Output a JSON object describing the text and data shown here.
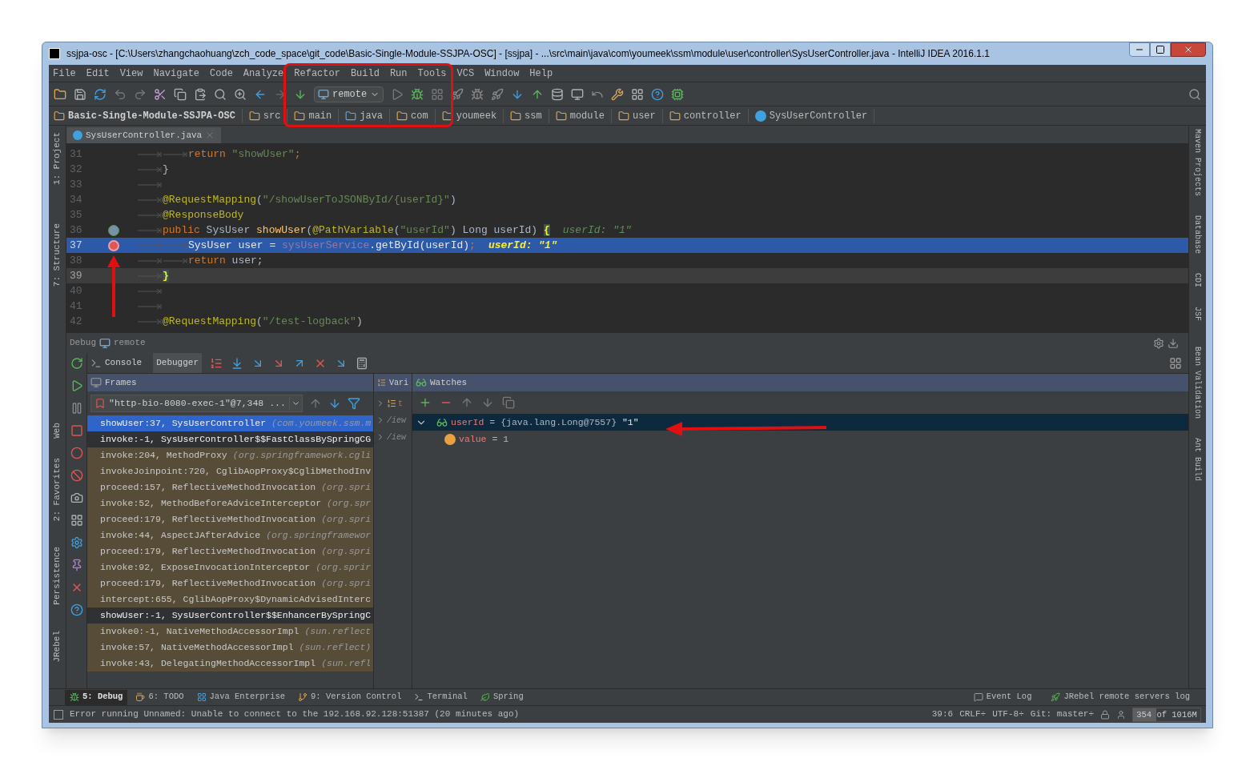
{
  "window": {
    "title": "ssjpa-osc - [C:\\Users\\zhangchaohuang\\zch_code_space\\git_code\\Basic-Single-Module-SSJPA-OSC] - [ssjpa] - ...\\src\\main\\java\\com\\youmeek\\ssm\\module\\user\\controller\\SysUserController.java - IntelliJ IDEA 2016.1.1"
  },
  "menu": [
    "File",
    "Edit",
    "View",
    "Navigate",
    "Code",
    "Analyze",
    "Refactor",
    "Build",
    "Run",
    "Tools",
    "VCS",
    "Window",
    "Help"
  ],
  "toolbar": {
    "run_config": "remote"
  },
  "breadcrumb": [
    {
      "label": "Basic-Single-Module-SSJPA-OSC",
      "kind": "project"
    },
    {
      "label": "src",
      "kind": "folder"
    },
    {
      "label": "main",
      "kind": "folder"
    },
    {
      "label": "java",
      "kind": "source"
    },
    {
      "label": "com",
      "kind": "folder"
    },
    {
      "label": "youmeek",
      "kind": "folder"
    },
    {
      "label": "ssm",
      "kind": "folder"
    },
    {
      "label": "module",
      "kind": "folder"
    },
    {
      "label": "user",
      "kind": "folder"
    },
    {
      "label": "controller",
      "kind": "folder"
    },
    {
      "label": "SysUserController",
      "kind": "class"
    }
  ],
  "left_stripe": [
    "1: Project",
    "7: Structure",
    "Web",
    "2: Favorites",
    "Persistence",
    "JRebel"
  ],
  "right_stripe": [
    "Maven Projects",
    "Database",
    "CDI",
    "JSF",
    "Bean Validation",
    "Ant Build"
  ],
  "editor": {
    "tabs": [
      {
        "label": "SysUserController.java",
        "selected": true
      }
    ],
    "lines": [
      {
        "number": "31",
        "current": false,
        "caret": false,
        "tokens": [
          {
            "tab": true
          },
          {
            "tab": true
          },
          {
            "keyword": "return"
          },
          {
            "string": " \"showUser\""
          },
          {
            "keyword": ";"
          }
        ]
      },
      {
        "number": "32",
        "current": false,
        "caret": false,
        "tokens": [
          {
            "tab": true
          },
          {
            "text": "}"
          }
        ]
      },
      {
        "number": "33",
        "current": false,
        "caret": false,
        "tokens": [
          {
            "tab": true
          }
        ]
      },
      {
        "number": "34",
        "current": false,
        "caret": false,
        "tokens": [
          {
            "tab": true
          },
          {
            "annotation": "@RequestMapping"
          },
          {
            "text": "("
          },
          {
            "string": "\"/showUserToJSONById/{userId}\""
          },
          {
            "text": ")"
          }
        ]
      },
      {
        "number": "35",
        "current": false,
        "caret": false,
        "tokens": [
          {
            "tab": true
          },
          {
            "annotation": "@ResponseBody"
          }
        ]
      },
      {
        "number": "36",
        "current": false,
        "caret": false,
        "override_marker": true,
        "breakpoint": false,
        "tokens": [
          {
            "tab": true
          },
          {
            "keyword": "public"
          },
          {
            "text": " SysUser "
          },
          {
            "method": "showUser"
          },
          {
            "text": "("
          },
          {
            "annotation": "@PathVariable"
          },
          {
            "text": "("
          },
          {
            "string": "\"userId\""
          },
          {
            "text": ") Long userId) "
          },
          {
            "brace": "{"
          },
          {
            "hint": "userId: \"1\""
          }
        ]
      },
      {
        "number": "37",
        "current": true,
        "caret": false,
        "override_marker": false,
        "breakpoint": true,
        "tokens": [
          {
            "tab": true
          },
          {
            "tab": true
          },
          {
            "text": "SysUser user = "
          },
          {
            "field": "sysUserService"
          },
          {
            "text": ".getById(userId)"
          },
          {
            "keyword": ";"
          },
          {
            "hint": "userId: \"1\""
          }
        ]
      },
      {
        "number": "38",
        "current": false,
        "caret": false,
        "tokens": [
          {
            "tab": true
          },
          {
            "tab": true
          },
          {
            "keyword": "return"
          },
          {
            "text": " user;"
          }
        ]
      },
      {
        "number": "39",
        "current": false,
        "caret": true,
        "tokens": [
          {
            "tab": true
          },
          {
            "brace": "}"
          }
        ]
      },
      {
        "number": "40",
        "current": false,
        "caret": false,
        "tokens": [
          {
            "tab": true
          }
        ]
      },
      {
        "number": "41",
        "current": false,
        "caret": false,
        "tokens": [
          {
            "tab": true
          }
        ]
      },
      {
        "number": "42",
        "current": false,
        "caret": false,
        "tokens": [
          {
            "tab": true
          },
          {
            "annotation": "@RequestMapping"
          },
          {
            "text": "("
          },
          {
            "string": "\"/test-logback\""
          },
          {
            "text": ")"
          }
        ]
      }
    ]
  },
  "debug": {
    "title": "Debug",
    "config": "remote",
    "tabs": [
      {
        "label": "Console",
        "selected": false
      },
      {
        "label": "Debugger",
        "selected": true
      }
    ],
    "frames": {
      "title": "Frames",
      "thread": "\"http-bio-8080-exec-1\"@7,348 ...",
      "rows": [
        {
          "text": "showUser:37, SysUserController",
          "package": "(com.youmeek.ssm.m",
          "selected": true,
          "kind": "project"
        },
        {
          "text": "invoke:-1, SysUserController$$FastClassBySpringCG",
          "selected": false,
          "kind": "project"
        },
        {
          "text": "invoke:204, MethodProxy",
          "package": "(org.springframework.cgli",
          "selected": false,
          "kind": "library"
        },
        {
          "text": "invokeJoinpoint:720, CglibAopProxy$CglibMethodInv",
          "selected": false,
          "kind": "library"
        },
        {
          "text": "proceed:157, ReflectiveMethodInvocation",
          "package": "(org.spri",
          "selected": false,
          "kind": "library"
        },
        {
          "text": "invoke:52, MethodBeforeAdviceInterceptor",
          "package": "(org.spr",
          "selected": false,
          "kind": "library"
        },
        {
          "text": "proceed:179, ReflectiveMethodInvocation",
          "package": "(org.spri",
          "selected": false,
          "kind": "library"
        },
        {
          "text": "invoke:44, AspectJAfterAdvice",
          "package": "(org.springframewor",
          "selected": false,
          "kind": "library"
        },
        {
          "text": "proceed:179, ReflectiveMethodInvocation",
          "package": "(org.spri",
          "selected": false,
          "kind": "library"
        },
        {
          "text": "invoke:92, ExposeInvocationInterceptor",
          "package": "(org.sprir",
          "selected": false,
          "kind": "library"
        },
        {
          "text": "proceed:179, ReflectiveMethodInvocation",
          "package": "(org.spri",
          "selected": false,
          "kind": "library"
        },
        {
          "text": "intercept:655, CglibAopProxy$DynamicAdvisedInterc",
          "selected": false,
          "kind": "library"
        },
        {
          "text": "showUser:-1, SysUserController$$EnhancerBySpringC",
          "selected": false,
          "kind": "project"
        },
        {
          "text": "invoke0:-1, NativeMethodAccessorImpl",
          "package": "(sun.reflect",
          "selected": false,
          "kind": "library"
        },
        {
          "text": "invoke:57, NativeMethodAccessorImpl",
          "package": "(sun.reflect)",
          "selected": false,
          "kind": "library"
        },
        {
          "text": "invoke:43, DelegatingMethodAccessorImpl",
          "package": "(sun.refl",
          "selected": false,
          "kind": "library"
        }
      ]
    },
    "variables": {
      "title": "Vari",
      "rows": [
        {
          "text": "t",
          "kind": "list"
        },
        {
          "text": "/iew",
          "kind": "object"
        },
        {
          "text": "/iew",
          "kind": "object"
        }
      ]
    },
    "watches": {
      "title": "Watches",
      "items": [
        {
          "name": "userId",
          "detail": "= {java.lang.Long@7557}",
          "value": "\"1\"",
          "expanded": true,
          "selected": true,
          "children": [
            {
              "name": "value",
              "detail": "= 1",
              "selected": false
            }
          ]
        }
      ]
    }
  },
  "tool_windows": [
    {
      "label": "5: Debug",
      "selected": true
    },
    {
      "label": "6: TODO",
      "selected": false
    },
    {
      "label": "Java Enterprise",
      "selected": false
    },
    {
      "label": "9: Version Control",
      "selected": false
    },
    {
      "label": "Terminal",
      "selected": false
    },
    {
      "label": "Spring",
      "selected": false
    }
  ],
  "tool_windows_right": [
    "Event Log",
    "JRebel remote servers log"
  ],
  "status": {
    "message": "Error running Unnamed: Unable to connect to the 192.168.92.128:51387 (20 minutes ago)",
    "position": "39:6",
    "line_separator": "CRLF÷",
    "encoding": "UTF-8÷",
    "vcs": "Git: master÷",
    "memory": {
      "text": "354 of 1016M",
      "level": 0.35
    }
  }
}
